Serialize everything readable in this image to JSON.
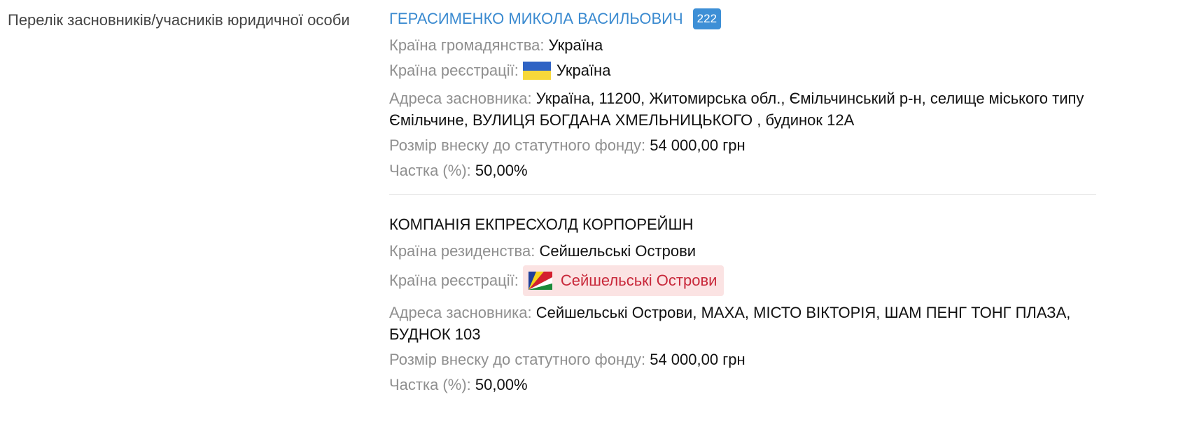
{
  "section": {
    "label": "Перелік засновників/учасників юридичної особи"
  },
  "founders": [
    {
      "name": "ГЕРАСИМЕНКО МИКОЛА ВАСИЛЬОВИЧ",
      "badge": "222",
      "citizenship_label": "Країна громадянства:",
      "citizenship_value": "Україна",
      "registration_label": "Країна реєстрації:",
      "registration_value": "Україна",
      "registration_flag": "ukraine-flag",
      "address_label": "Адреса засновника:",
      "address_value": "Україна, 11200, Житомирська обл., Ємільчинський р-н, селище міського типу Ємільчине, ВУЛИЦЯ БОГДАНА ХМЕЛЬНИЦЬКОГО , будинок 12А",
      "contribution_label": "Розмір внеску до статутного фонду:",
      "contribution_value": "54 000,00 грн",
      "share_label": "Частка (%):",
      "share_value": "50,00%"
    },
    {
      "name": "КОМПАНІЯ ЕКПРЕСХОЛД КОРПОРЕЙШН",
      "residence_label": "Країна резиденства:",
      "residence_value": "Сейшельські Острови",
      "registration_label": "Країна реєстрації:",
      "registration_value": "Сейшельські Острови",
      "registration_flag": "seychelles-flag",
      "address_label": "Адреса засновника:",
      "address_value": "Сейшельські Острови, МАХА, МІСТО ВІКТОРІЯ, ШАМ ПЕНГ ТОНГ ПЛАЗА, БУДНОК 103",
      "contribution_label": "Розмір внеску до статутного фонду:",
      "contribution_value": "54 000,00 грн",
      "share_label": "Частка (%):",
      "share_value": "50,00%"
    }
  ],
  "colors": {
    "link": "#3a8ad0",
    "badge": "#3d8fd6",
    "muted_label": "#8f8f8f",
    "warning_text": "#c8283a",
    "warning_bg": "#fbe3e3",
    "ua_blue": "#2f63c4",
    "ua_yellow": "#f7d83a"
  }
}
